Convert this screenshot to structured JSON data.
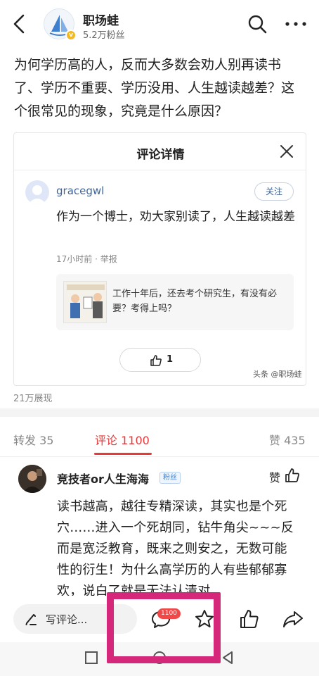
{
  "header": {
    "author_name": "职场蛙",
    "author_fans": "5.2万粉丝"
  },
  "post": {
    "title": "为何学历高的人，反而大多数会劝人别再读书了、学历不重要、学历没用、人生越读越差？这个很常见的现象，究竟是什么原因？"
  },
  "card": {
    "title": "评论详情",
    "commenter": "gracegwl",
    "follow_label": "关注",
    "comment_text": "作为一个博士，劝大家别读了，人生越读越差",
    "meta": "17小时前 · 举报",
    "quote_text": "工作十年后，还去考个研究生，有没有必要？考得上吗？",
    "like_count": "1",
    "watermark": "头条 @职场蛙"
  },
  "views": "21万展现",
  "tabs": {
    "repost": "转发 35",
    "comments": "评论 1100",
    "likes": "赞 435"
  },
  "comment": {
    "author": "竞技者or人生海海",
    "badge": "粉丝",
    "like_label": "赞",
    "body": "读书越高，越往专精深读，其实也是个死穴……进入一个死胡同，钻牛角尖~~~反而是宽泛教育，既来之则安之，无数可能性的衍生！为什么高学历的人有些郁郁寡欢，说白了就是无法认清对"
  },
  "action_bar": {
    "input_placeholder": "写评论...",
    "comment_badge": "1100"
  },
  "colors": {
    "accent": "#e5393a",
    "link_blue": "#406599",
    "highlight": "#d6287a",
    "badge_red": "#f04848"
  }
}
